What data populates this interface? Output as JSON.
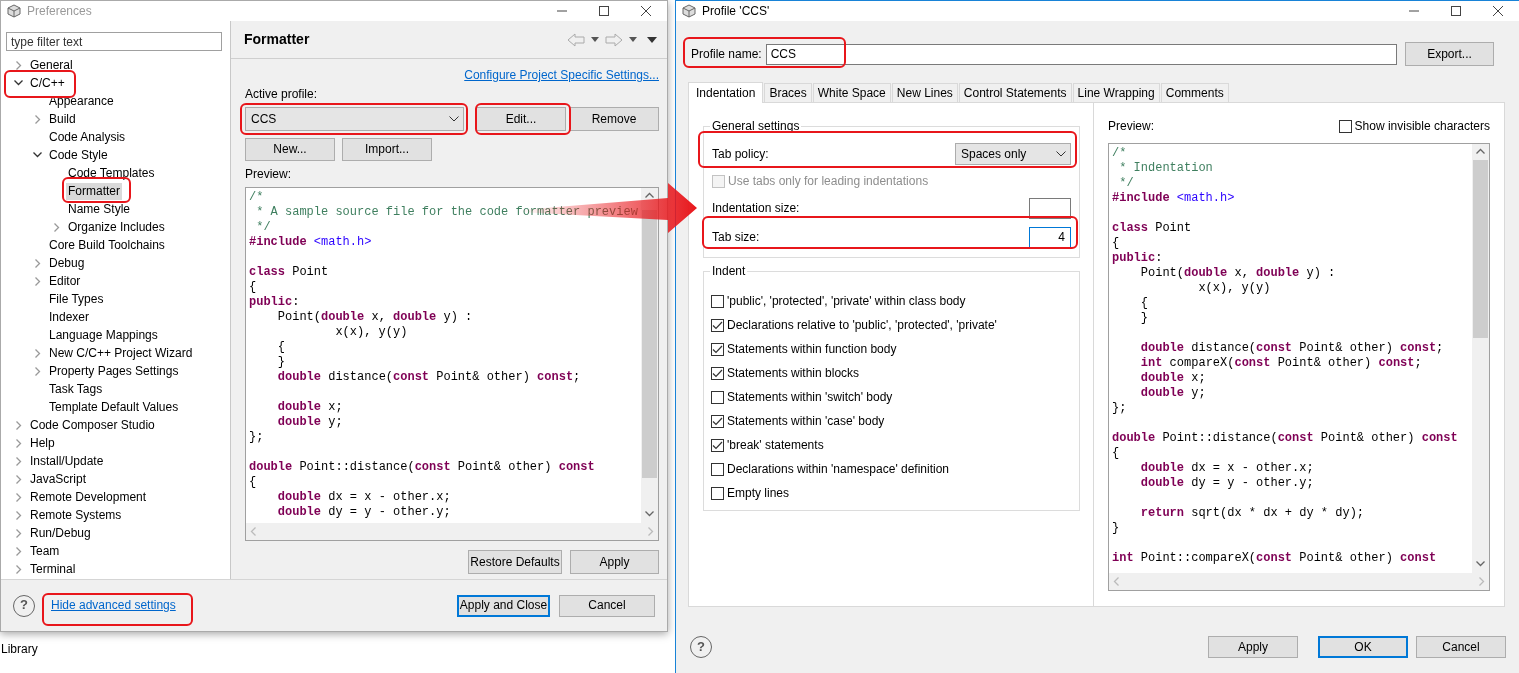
{
  "background": {
    "text": "Library"
  },
  "preferences_window": {
    "title": "Preferences",
    "filter": {
      "placeholder": "type filter text"
    },
    "tree": [
      {
        "label": "General",
        "expanded": false,
        "selected": false
      },
      {
        "label": "C/C++",
        "expanded": true,
        "selected": false,
        "children": [
          {
            "label": "Appearance",
            "selected": false
          },
          {
            "label": "Build",
            "expanded": false,
            "selected": false
          },
          {
            "label": "Code Analysis",
            "selected": false
          },
          {
            "label": "Code Style",
            "expanded": true,
            "selected": false,
            "children": [
              {
                "label": "Code Templates",
                "selected": false
              },
              {
                "label": "Formatter",
                "selected": true
              },
              {
                "label": "Name Style",
                "selected": false
              },
              {
                "label": "Organize Includes",
                "expanded": false,
                "selected": false
              }
            ]
          },
          {
            "label": "Core Build Toolchains",
            "selected": false
          },
          {
            "label": "Debug",
            "expanded": false,
            "selected": false
          },
          {
            "label": "Editor",
            "expanded": false,
            "selected": false
          },
          {
            "label": "File Types",
            "selected": false
          },
          {
            "label": "Indexer",
            "selected": false
          },
          {
            "label": "Language Mappings",
            "selected": false
          },
          {
            "label": "New C/C++ Project Wizard",
            "expanded": false,
            "selected": false
          },
          {
            "label": "Property Pages Settings",
            "expanded": false,
            "selected": false
          },
          {
            "label": "Task Tags",
            "selected": false
          },
          {
            "label": "Template Default Values",
            "selected": false
          }
        ]
      },
      {
        "label": "Code Composer Studio",
        "expanded": false,
        "selected": false
      },
      {
        "label": "Help",
        "expanded": false,
        "selected": false
      },
      {
        "label": "Install/Update",
        "expanded": false,
        "selected": false
      },
      {
        "label": "JavaScript",
        "expanded": false,
        "selected": false
      },
      {
        "label": "Remote Development",
        "expanded": false,
        "selected": false
      },
      {
        "label": "Remote Systems",
        "expanded": false,
        "selected": false
      },
      {
        "label": "Run/Debug",
        "expanded": false,
        "selected": false
      },
      {
        "label": "Team",
        "expanded": false,
        "selected": false
      },
      {
        "label": "Terminal",
        "expanded": false,
        "selected": false
      }
    ],
    "page_title": "Formatter",
    "configure_link": "Configure Project Specific Settings...",
    "active_profile_label": "Active profile:",
    "active_profile": "CCS",
    "profile_buttons": [
      "Edit...",
      "Remove"
    ],
    "profile_buttons_2": [
      "New...",
      "Import..."
    ],
    "preview_label": "Preview:",
    "preview_lines": [
      {
        "kind": "code",
        "segments": [
          {
            "kind": "comment",
            "text": "/*"
          }
        ]
      },
      {
        "kind": "code",
        "segments": [
          {
            "kind": "comment",
            "text": " * A sample source file for the code formatter preview"
          }
        ]
      },
      {
        "kind": "code",
        "segments": [
          {
            "kind": "comment",
            "text": " */"
          }
        ]
      },
      {
        "kind": "code",
        "segments": [
          {
            "kind": "keyword",
            "text": "#include "
          },
          {
            "kind": "string",
            "text": "<math.h>"
          }
        ]
      },
      {
        "kind": "blank"
      },
      {
        "kind": "code",
        "segments": [
          {
            "kind": "keyword",
            "text": "class"
          },
          {
            "kind": "plain",
            "text": " Point"
          }
        ]
      },
      {
        "kind": "code",
        "segments": [
          {
            "kind": "plain",
            "text": "{"
          }
        ]
      },
      {
        "kind": "code",
        "segments": [
          {
            "kind": "keyword",
            "text": "public"
          },
          {
            "kind": "plain",
            "text": ":"
          }
        ]
      },
      {
        "kind": "code",
        "segments": [
          {
            "kind": "plain",
            "text": "    Point("
          },
          {
            "kind": "keyword",
            "text": "double"
          },
          {
            "kind": "plain",
            "text": " x, "
          },
          {
            "kind": "keyword",
            "text": "double"
          },
          {
            "kind": "plain",
            "text": " y) :"
          }
        ]
      },
      {
        "kind": "code",
        "segments": [
          {
            "kind": "plain",
            "text": "            x(x), y(y)"
          }
        ]
      },
      {
        "kind": "code",
        "segments": [
          {
            "kind": "plain",
            "text": "    {"
          }
        ]
      },
      {
        "kind": "code",
        "segments": [
          {
            "kind": "plain",
            "text": "    }"
          }
        ]
      },
      {
        "kind": "code",
        "segments": [
          {
            "kind": "keyword",
            "text": "    double"
          },
          {
            "kind": "plain",
            "text": " distance("
          },
          {
            "kind": "keyword",
            "text": "const"
          },
          {
            "kind": "plain",
            "text": " Point& other) "
          },
          {
            "kind": "keyword",
            "text": "const"
          },
          {
            "kind": "plain",
            "text": ";"
          }
        ]
      },
      {
        "kind": "blank"
      },
      {
        "kind": "code",
        "segments": [
          {
            "kind": "keyword",
            "text": "    double"
          },
          {
            "kind": "plain",
            "text": " x;"
          }
        ]
      },
      {
        "kind": "code",
        "segments": [
          {
            "kind": "keyword",
            "text": "    double"
          },
          {
            "kind": "plain",
            "text": " y;"
          }
        ]
      },
      {
        "kind": "code",
        "segments": [
          {
            "kind": "plain",
            "text": "};"
          }
        ]
      },
      {
        "kind": "blank"
      },
      {
        "kind": "code",
        "segments": [
          {
            "kind": "keyword",
            "text": "double"
          },
          {
            "kind": "plain",
            "text": " Point::distance("
          },
          {
            "kind": "keyword",
            "text": "const"
          },
          {
            "kind": "plain",
            "text": " Point& other) "
          },
          {
            "kind": "keyword",
            "text": "const"
          }
        ]
      },
      {
        "kind": "code",
        "segments": [
          {
            "kind": "plain",
            "text": "{"
          }
        ]
      },
      {
        "kind": "code",
        "segments": [
          {
            "kind": "keyword",
            "text": "    double"
          },
          {
            "kind": "plain",
            "text": " dx = x - other.x;"
          }
        ]
      },
      {
        "kind": "code",
        "segments": [
          {
            "kind": "keyword",
            "text": "    double"
          },
          {
            "kind": "plain",
            "text": " dy = y - other.y;"
          }
        ]
      }
    ],
    "page_buttons": [
      "Restore Defaults",
      "Apply"
    ],
    "help": "?",
    "advanced_link": "Hide advanced settings",
    "footer_buttons": [
      {
        "label": "Apply and Close",
        "default": true
      },
      {
        "label": "Cancel",
        "default": false
      }
    ]
  },
  "profile_window": {
    "title": "Profile 'CCS'",
    "profile_name_label": "Profile name:",
    "profile_name": "CCS",
    "export_button": "Export...",
    "tabs": [
      {
        "label": "Indentation",
        "selected": true
      },
      {
        "label": "Braces",
        "selected": false
      },
      {
        "label": "White Space",
        "selected": false
      },
      {
        "label": "New Lines",
        "selected": false
      },
      {
        "label": "Control Statements",
        "selected": false
      },
      {
        "label": "Line Wrapping",
        "selected": false
      },
      {
        "label": "Comments",
        "selected": false
      }
    ],
    "general_settings": {
      "title": "General settings",
      "tab_policy_label": "Tab policy:",
      "tab_policy": "Spaces only",
      "use_tabs": {
        "label": "Use tabs only for leading indentations",
        "checked": false,
        "disabled": true
      },
      "indentation_size_label": "Indentation size:",
      "indentation_size": {
        "focused": false
      },
      "tab_size_label": "Tab size:",
      "tab_size": {
        "value": "4",
        "focused": true
      }
    },
    "indent": {
      "title": "Indent",
      "options": [
        {
          "label": "'public', 'protected', 'private' within class body",
          "checked": false
        },
        {
          "label": "Declarations relative to 'public', 'protected', 'private'",
          "checked": true
        },
        {
          "label": "Statements within function body",
          "checked": true
        },
        {
          "label": "Statements within blocks",
          "checked": true
        },
        {
          "label": "Statements within 'switch' body",
          "checked": false
        },
        {
          "label": "Statements within 'case' body",
          "checked": true
        },
        {
          "label": "'break' statements",
          "checked": true
        },
        {
          "label": "Declarations within 'namespace' definition",
          "checked": false
        },
        {
          "label": "Empty lines",
          "checked": false
        }
      ]
    },
    "preview_label": "Preview:",
    "show_invisible": {
      "label": "Show invisible characters",
      "checked": false
    },
    "preview_lines": [
      {
        "kind": "code",
        "segments": [
          {
            "kind": "comment",
            "text": "/*"
          }
        ]
      },
      {
        "kind": "code",
        "segments": [
          {
            "kind": "comment",
            "text": " * Indentation"
          }
        ]
      },
      {
        "kind": "code",
        "segments": [
          {
            "kind": "comment",
            "text": " */"
          }
        ]
      },
      {
        "kind": "code",
        "segments": [
          {
            "kind": "keyword",
            "text": "#include "
          },
          {
            "kind": "string",
            "text": "<math.h>"
          }
        ]
      },
      {
        "kind": "blank"
      },
      {
        "kind": "code",
        "segments": [
          {
            "kind": "keyword",
            "text": "class"
          },
          {
            "kind": "plain",
            "text": " Point"
          }
        ]
      },
      {
        "kind": "code",
        "segments": [
          {
            "kind": "plain",
            "text": "{"
          }
        ]
      },
      {
        "kind": "code",
        "segments": [
          {
            "kind": "keyword",
            "text": "public"
          },
          {
            "kind": "plain",
            "text": ":"
          }
        ]
      },
      {
        "kind": "code",
        "segments": [
          {
            "kind": "plain",
            "text": "    Point("
          },
          {
            "kind": "keyword",
            "text": "double"
          },
          {
            "kind": "plain",
            "text": " x, "
          },
          {
            "kind": "keyword",
            "text": "double"
          },
          {
            "kind": "plain",
            "text": " y) :"
          }
        ]
      },
      {
        "kind": "code",
        "segments": [
          {
            "kind": "plain",
            "text": "            x(x), y(y)"
          }
        ]
      },
      {
        "kind": "code",
        "segments": [
          {
            "kind": "plain",
            "text": "    {"
          }
        ]
      },
      {
        "kind": "code",
        "segments": [
          {
            "kind": "plain",
            "text": "    }"
          }
        ]
      },
      {
        "kind": "blank"
      },
      {
        "kind": "code",
        "segments": [
          {
            "kind": "keyword",
            "text": "    double"
          },
          {
            "kind": "plain",
            "text": " distance("
          },
          {
            "kind": "keyword",
            "text": "const"
          },
          {
            "kind": "plain",
            "text": " Point& other) "
          },
          {
            "kind": "keyword",
            "text": "const"
          },
          {
            "kind": "plain",
            "text": ";"
          }
        ]
      },
      {
        "kind": "code",
        "segments": [
          {
            "kind": "keyword",
            "text": "    int"
          },
          {
            "kind": "plain",
            "text": " compareX("
          },
          {
            "kind": "keyword",
            "text": "const"
          },
          {
            "kind": "plain",
            "text": " Point& other) "
          },
          {
            "kind": "keyword",
            "text": "const"
          },
          {
            "kind": "plain",
            "text": ";"
          }
        ]
      },
      {
        "kind": "code",
        "segments": [
          {
            "kind": "keyword",
            "text": "    double"
          },
          {
            "kind": "plain",
            "text": " x;"
          }
        ]
      },
      {
        "kind": "code",
        "segments": [
          {
            "kind": "keyword",
            "text": "    double"
          },
          {
            "kind": "plain",
            "text": " y;"
          }
        ]
      },
      {
        "kind": "code",
        "segments": [
          {
            "kind": "plain",
            "text": "};"
          }
        ]
      },
      {
        "kind": "blank"
      },
      {
        "kind": "code",
        "segments": [
          {
            "kind": "keyword",
            "text": "double"
          },
          {
            "kind": "plain",
            "text": " Point::distance("
          },
          {
            "kind": "keyword",
            "text": "const"
          },
          {
            "kind": "plain",
            "text": " Point& other) "
          },
          {
            "kind": "keyword",
            "text": "const"
          }
        ]
      },
      {
        "kind": "code",
        "segments": [
          {
            "kind": "plain",
            "text": "{"
          }
        ]
      },
      {
        "kind": "code",
        "segments": [
          {
            "kind": "keyword",
            "text": "    double"
          },
          {
            "kind": "plain",
            "text": " dx = x - other.x;"
          }
        ]
      },
      {
        "kind": "code",
        "segments": [
          {
            "kind": "keyword",
            "text": "    double"
          },
          {
            "kind": "plain",
            "text": " dy = y - other.y;"
          }
        ]
      },
      {
        "kind": "blank"
      },
      {
        "kind": "code",
        "segments": [
          {
            "kind": "keyword",
            "text": "    return"
          },
          {
            "kind": "plain",
            "text": " sqrt(dx * dx + dy * dy);"
          }
        ]
      },
      {
        "kind": "code",
        "segments": [
          {
            "kind": "plain",
            "text": "}"
          }
        ]
      },
      {
        "kind": "blank"
      },
      {
        "kind": "code",
        "segments": [
          {
            "kind": "keyword",
            "text": "int"
          },
          {
            "kind": "plain",
            "text": " Point::compareX("
          },
          {
            "kind": "keyword",
            "text": "const"
          },
          {
            "kind": "plain",
            "text": " Point& other) "
          },
          {
            "kind": "keyword",
            "text": "const"
          }
        ]
      }
    ],
    "help": "?",
    "buttons": [
      {
        "label": "Apply",
        "default": false
      },
      {
        "label": "OK",
        "default": true
      },
      {
        "label": "Cancel",
        "default": false
      }
    ]
  }
}
